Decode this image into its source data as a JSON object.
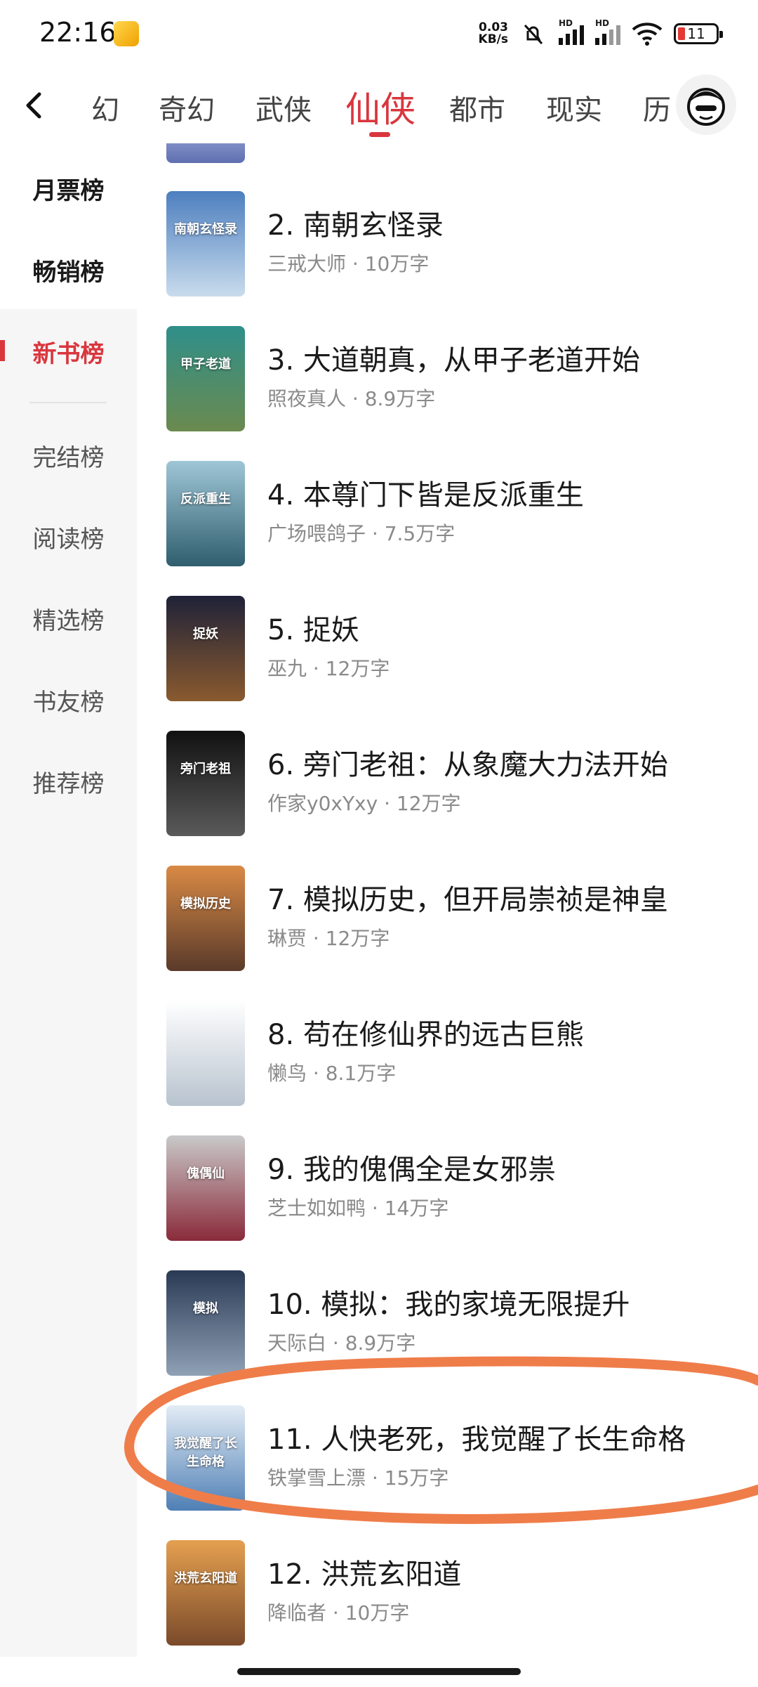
{
  "status_bar": {
    "time": "22:16",
    "net_speed_value": "0.03",
    "net_speed_unit": "KB/s",
    "signal_label": "HD",
    "battery": "11"
  },
  "category_tabs": [
    {
      "label": "幻",
      "active": false
    },
    {
      "label": "奇幻",
      "active": false
    },
    {
      "label": "武侠",
      "active": false
    },
    {
      "label": "仙侠",
      "active": true
    },
    {
      "label": "都市",
      "active": false
    },
    {
      "label": "现实",
      "active": false
    },
    {
      "label": "历",
      "active": false
    }
  ],
  "sidebar": {
    "items": [
      {
        "label": "月票榜",
        "state": "bold"
      },
      {
        "label": "畅销榜",
        "state": "bold"
      },
      {
        "label": "新书榜",
        "state": "current"
      },
      {
        "label": "完结榜",
        "state": "normal"
      },
      {
        "label": "阅读榜",
        "state": "normal"
      },
      {
        "label": "精选榜",
        "state": "normal"
      },
      {
        "label": "书友榜",
        "state": "normal"
      },
      {
        "label": "推荐榜",
        "state": "normal"
      }
    ]
  },
  "books": [
    {
      "title": "2. 南朝玄怪录",
      "meta": "三戒大师 · 10万字",
      "cover_text": "南朝玄怪录",
      "cover_colors": [
        "#4d7fbf",
        "#c9dced"
      ]
    },
    {
      "title": "3. 大道朝真，从甲子老道开始",
      "meta": "照夜真人 · 8.9万字",
      "cover_text": "甲子老道",
      "cover_colors": [
        "#2f8f8a",
        "#6b8a4f"
      ]
    },
    {
      "title": "4. 本尊门下皆是反派重生",
      "meta": "广场喂鸽子 · 7.5万字",
      "cover_text": "反派重生",
      "cover_colors": [
        "#9fc6d6",
        "#2f5e6e"
      ]
    },
    {
      "title": "5. 捉妖",
      "meta": "巫九 · 12万字",
      "cover_text": "捉妖",
      "cover_colors": [
        "#1f2238",
        "#8a5a2f"
      ]
    },
    {
      "title": "6. 旁门老祖：从象魔大力法开始",
      "meta": "作家y0xYxy · 12万字",
      "cover_text": "旁门老祖",
      "cover_colors": [
        "#111111",
        "#5a5a5a"
      ]
    },
    {
      "title": "7. 模拟历史，但开局崇祯是神皇",
      "meta": "琳贾 · 12万字",
      "cover_text": "模拟历史",
      "cover_colors": [
        "#d98a45",
        "#5a3a2a"
      ]
    },
    {
      "title": "8. 苟在修仙界的远古巨熊",
      "meta": "懒鸟 · 8.1万字",
      "cover_text": "",
      "cover_colors": [
        "#ffffff",
        "#b8c3cf"
      ]
    },
    {
      "title": "9. 我的傀偶全是女邪祟",
      "meta": "芝士如如鸭 · 14万字",
      "cover_text": "傀偶仙",
      "cover_colors": [
        "#c9c9c9",
        "#8a2a3a"
      ]
    },
    {
      "title": "10. 模拟：我的家境无限提升",
      "meta": "天际白 · 8.9万字",
      "cover_text": "模拟",
      "cover_colors": [
        "#2a3a55",
        "#8fa1b5"
      ]
    },
    {
      "title": "11. 人快老死，我觉醒了长生命格",
      "meta": "铁掌雪上漂 · 15万字",
      "cover_text": "我觉醒了长生命格",
      "cover_colors": [
        "#e3ecf5",
        "#4f7fb5"
      ]
    },
    {
      "title": "12. 洪荒玄阳道",
      "meta": "降临者 · 10万字",
      "cover_text": "洪荒玄阳道",
      "cover_colors": [
        "#e5a050",
        "#7a4a2a"
      ]
    }
  ],
  "colors": {
    "accent": "#d9363e",
    "annotation_stroke": "#ef7d4a"
  }
}
